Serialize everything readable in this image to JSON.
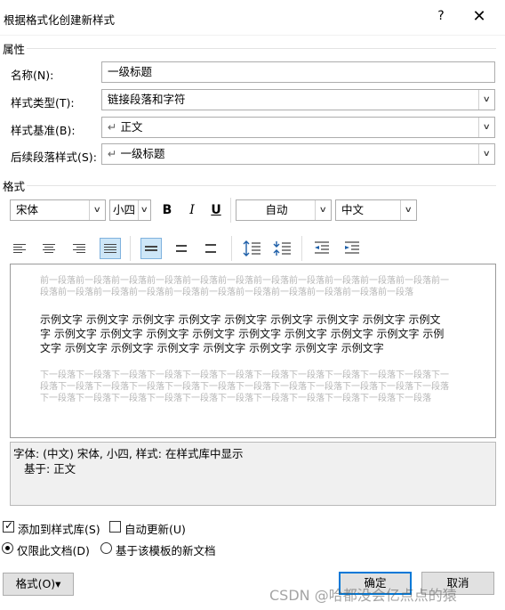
{
  "window": {
    "title": "根据格式化创建新样式",
    "help": "?",
    "close": "✕"
  },
  "properties": {
    "section_label": "属性",
    "name_label": "名称(N):",
    "name_value": "一级标题",
    "type_label": "样式类型(T):",
    "type_value": "链接段落和字符",
    "based_label": "样式基准(B):",
    "based_value": "正文",
    "next_label": "后续段落样式(S):",
    "next_value": "一级标题",
    "para_mark": "↵"
  },
  "format": {
    "section_label": "格式",
    "font": "宋体",
    "size": "小四",
    "bold": "B",
    "italic": "I",
    "underline": "U",
    "color": "自动",
    "script": "中文"
  },
  "preview": {
    "prev_text": "前一段落前一段落前一段落前一段落前一段落前一段落前一段落前一段落前一段落前一段落前一段落前一段落前一段落前一段落前一段落前一段落前一段落前一段落前一段落前一段落前一段落前一段落",
    "sample_text": "示例文字 示例文字 示例文字 示例文字 示例文字 示例文字 示例文字 示例文字 示例文字 示例文字 示例文字 示例文字 示例文字 示例文字 示例文字 示例文字 示例文字 示例文字 示例文字 示例文字 示例文字 示例文字 示例文字 示例文字 示例文字",
    "next_text": "下一段落下一段落下一段落下一段落下一段落下一段落下一段落下一段落下一段落下一段落下一段落下一段落下一段落下一段落下一段落下一段落下一段落下一段落下一段落下一段落下一段落下一段落下一段落下一段落下一段落下一段落下一段落下一段落下一段落下一段落下一段落下一段落下一段落下一段落"
  },
  "description": {
    "line1": "字体: (中文) 宋体, 小四, 样式: 在样式库中显示",
    "line2": "基于: 正文"
  },
  "options": {
    "add_to_gallery": "添加到样式库(S)",
    "add_to_gallery_checked": true,
    "auto_update": "自动更新(U)",
    "auto_update_checked": false,
    "only_this_doc": "仅限此文档(D)",
    "template_docs": "基于该模板的新文档"
  },
  "buttons": {
    "format": "格式(O)",
    "format_arrow": "▾",
    "ok": "确定",
    "cancel": "取消"
  },
  "watermark": "CSDN @哈都没会亿点点的猿"
}
